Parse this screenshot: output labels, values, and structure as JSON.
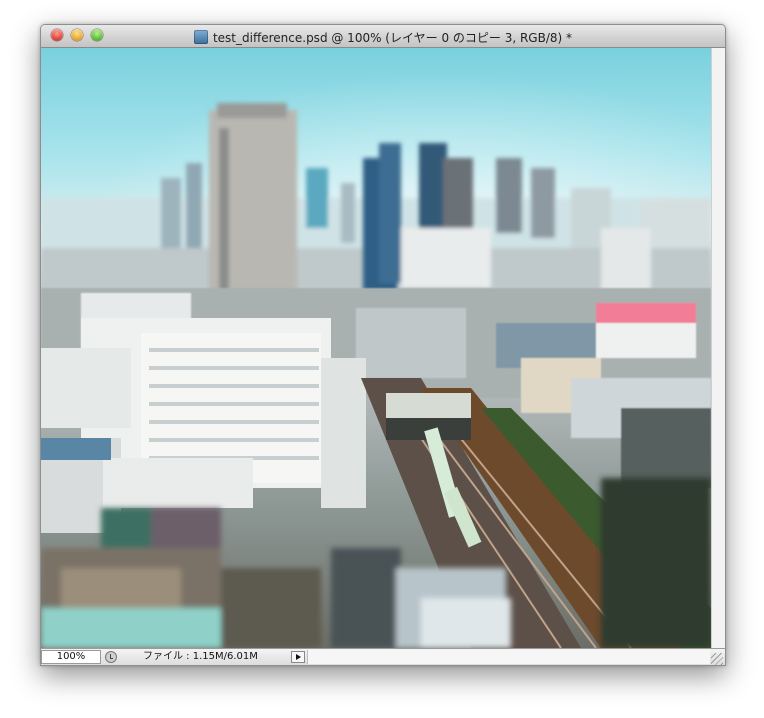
{
  "window": {
    "title": "test_difference.psd @ 100% (レイヤー 0 のコピー 3, RGB/8) *",
    "doc_icon": "psd-document-icon",
    "controls": [
      "close-button",
      "minimize-button",
      "zoom-button"
    ]
  },
  "canvas": {
    "description_icon": "photo-canvas",
    "colors": {
      "sky": "#79d1de",
      "haze": "#d9eef0",
      "buildings_light": "#eef1ef",
      "buildings_dark": "#3e4d55",
      "tracks": "#6d4a2c",
      "trees": "#3b5a2e",
      "pink_building": "#f27d96"
    }
  },
  "status": {
    "zoom": "100%",
    "info_icon": "clock-icon",
    "file_info": "ファイル : 1.15M/6.01M",
    "menu_arrow_icon": "triangle-right-icon"
  }
}
